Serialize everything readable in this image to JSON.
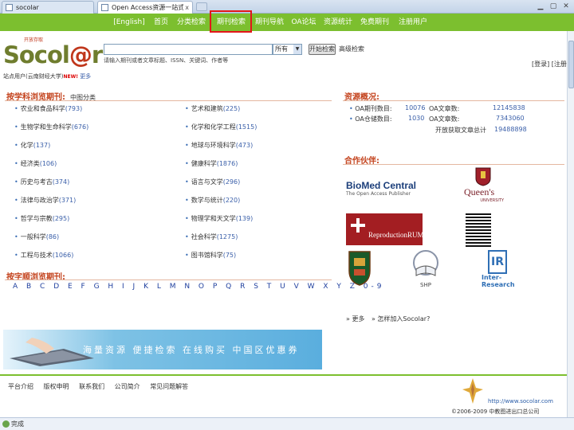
{
  "browser": {
    "tabs": [
      {
        "title": "socolar"
      },
      {
        "title": "Open Access资源一站式 ..."
      }
    ],
    "close_glyph": "x"
  },
  "nav": {
    "items": [
      "[English]",
      "首页",
      "分类检索",
      "期刊检索",
      "期刊导航",
      "OA论坛",
      "资源统计",
      "免费期刊",
      "注册用户"
    ],
    "active": "期刊检索"
  },
  "logo": {
    "brand": "Socol@r",
    "brand_pre": "Socol",
    "brand_at": "@",
    "brand_post": "r",
    "tag": "开放存取"
  },
  "search": {
    "value": "",
    "scope": "所有",
    "button": "开始检索",
    "advanced": "高级检索",
    "hint": "请输入期刊或者文章标题、ISSN、关键词、作者等",
    "sub": "站点用户(云南财经大学)",
    "sub_new": "NEW!",
    "sub_more": "更多"
  },
  "user_links": "[登录] [注册]",
  "subjects_section": {
    "title": "按学科浏览期刊:",
    "sub": "中图分类"
  },
  "subjects": [
    {
      "name": "农业和食品科学",
      "count": "(793)"
    },
    {
      "name": "艺术和建筑",
      "count": "(225)"
    },
    {
      "name": "生物学和生命科学",
      "count": "(676)"
    },
    {
      "name": "化学和化学工程",
      "count": "(1515)"
    },
    {
      "name": "化学",
      "count": "(137)"
    },
    {
      "name": "地球与环境科学",
      "count": "(473)"
    },
    {
      "name": "经济类",
      "count": "(106)"
    },
    {
      "name": "健康科学",
      "count": "(1876)"
    },
    {
      "name": "历史与考古",
      "count": "(374)"
    },
    {
      "name": "语言与文学",
      "count": "(296)"
    },
    {
      "name": "法律与政治学",
      "count": "(371)"
    },
    {
      "name": "数学与统计",
      "count": "(220)"
    },
    {
      "name": "哲学与宗教",
      "count": "(295)"
    },
    {
      "name": "物理学和天文学",
      "count": "(139)"
    },
    {
      "name": "一般科学",
      "count": "(86)"
    },
    {
      "name": "社会科学",
      "count": "(1275)"
    },
    {
      "name": "工程与技术",
      "count": "(1066)"
    },
    {
      "name": "图书馆科学",
      "count": "(75)"
    }
  ],
  "alpha_section": {
    "title": "按字顺浏览期刊:"
  },
  "alphabet": "A B C D E F G H I J K L M N O P Q R S T U V W X Y Z 0-9",
  "overview": {
    "title": "资源概况:",
    "rows": [
      {
        "label": "OA期刊数目:",
        "a": "10076",
        "b_label": "OA文章数:",
        "b": "12145838"
      },
      {
        "label": "OA仓储数目:",
        "a": "1030",
        "b_label": "OA文章数:",
        "b": "7343060"
      }
    ],
    "total_label": "开放获取文章总计",
    "total": "19488898"
  },
  "partners": {
    "title": "合作伙伴:",
    "names": [
      "BioMed Central",
      "Queen's",
      "ReproductionRUM",
      "",
      "",
      "SHP",
      "IR Inter-Research"
    ],
    "biomed_sub": "The Open Access Publisher",
    "queens_sub": "UNIVERSITY",
    "ir_line1": "Inter-",
    "ir_line2": "Research",
    "shp": "SHP",
    "more": "» 更多",
    "join": "» 怎样加入Socolar?"
  },
  "banner": {
    "slogan": "海量资源  便捷检索  在线购买  中国区优惠券"
  },
  "footer": {
    "links": [
      "平台介绍",
      "版权申明",
      "联系我们",
      "公司简介",
      "常见问题解答"
    ],
    "url": "http://www.socolar.com",
    "copyright": "©2006-2009 中教图进出口总公司"
  },
  "statusbar": {
    "text": "完成"
  },
  "colors": {
    "nav_green": "#7cbf2f",
    "highlight_red": "#e3161a",
    "heading": "#c3411b",
    "link_blue": "#3a5fa9"
  }
}
